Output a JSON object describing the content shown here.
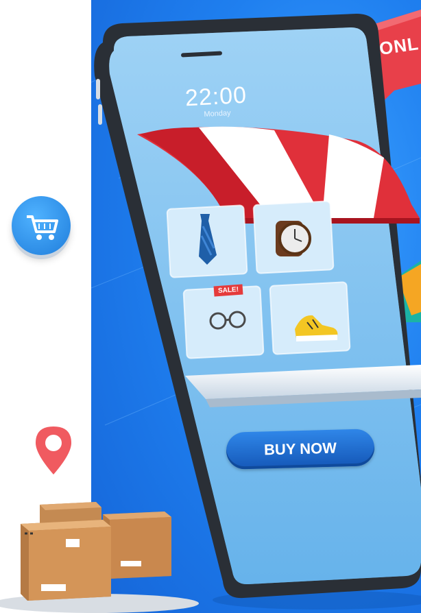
{
  "phone": {
    "time": "22:00",
    "day": "Monday",
    "buy_button_label": "BUY NOW",
    "sale_tag": "SALE!"
  },
  "bubble": {
    "text": "ONL"
  },
  "products": [
    {
      "icon": "tie-icon"
    },
    {
      "icon": "watch-icon"
    },
    {
      "icon": "glasses-icon"
    },
    {
      "icon": "sneaker-icon"
    }
  ],
  "colors": {
    "background_blue": "#1f7fef",
    "awning_red": "#e0303a",
    "bubble_red": "#e8404a",
    "pin_red": "#f05a60",
    "button_blue": "#1f6fd0"
  }
}
